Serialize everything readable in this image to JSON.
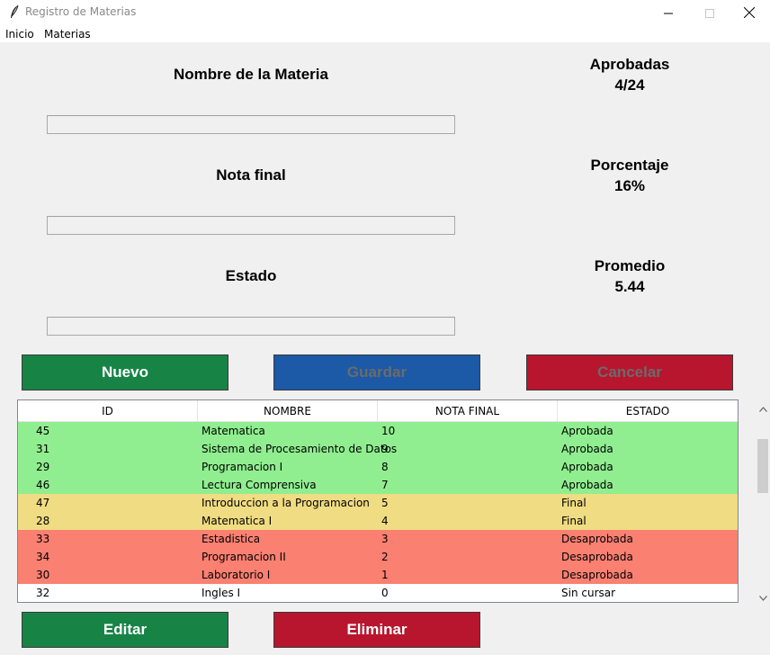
{
  "window": {
    "title": "Registro de Materias"
  },
  "menu": {
    "items": [
      "Inicio",
      "Materias"
    ]
  },
  "form": {
    "nombre_label": "Nombre de la Materia",
    "nota_label": "Nota final",
    "estado_label": "Estado",
    "nombre_value": "",
    "nota_value": "",
    "estado_value": ""
  },
  "stats": {
    "aprobadas_label": "Aprobadas",
    "aprobadas_value": "4/24",
    "porcentaje_label": "Porcentaje",
    "porcentaje_value": "16%",
    "promedio_label": "Promedio",
    "promedio_value": "5.44"
  },
  "buttons": {
    "nuevo": "Nuevo",
    "guardar": "Guardar",
    "cancelar": "Cancelar",
    "editar": "Editar",
    "eliminar": "Eliminar"
  },
  "table": {
    "headers": [
      "ID",
      "NOMBRE",
      "NOTA FINAL",
      "ESTADO"
    ],
    "rows": [
      {
        "id": "45",
        "nombre": "Matematica",
        "nota": "10",
        "estado": "Aprobada",
        "color": "#90ee90"
      },
      {
        "id": "31",
        "nombre": "Sistema de Procesamiento de Datos",
        "nota": "9",
        "estado": "Aprobada",
        "color": "#90ee90"
      },
      {
        "id": "29",
        "nombre": "Programacion I",
        "nota": "8",
        "estado": "Aprobada",
        "color": "#90ee90"
      },
      {
        "id": "46",
        "nombre": "Lectura Comprensiva",
        "nota": "7",
        "estado": "Aprobada",
        "color": "#90ee90"
      },
      {
        "id": "47",
        "nombre": "Introduccion a la Programacion",
        "nota": "5",
        "estado": "Final",
        "color": "#f0dc82"
      },
      {
        "id": "28",
        "nombre": "Matematica I",
        "nota": "4",
        "estado": "Final",
        "color": "#f0dc82"
      },
      {
        "id": "33",
        "nombre": "Estadistica",
        "nota": "3",
        "estado": "Desaprobada",
        "color": "#fa8072"
      },
      {
        "id": "34",
        "nombre": "Programacion II",
        "nota": "2",
        "estado": "Desaprobada",
        "color": "#fa8072"
      },
      {
        "id": "30",
        "nombre": "Laboratorio I",
        "nota": "1",
        "estado": "Desaprobada",
        "color": "#fa8072"
      },
      {
        "id": "32",
        "nombre": "Ingles I",
        "nota": "0",
        "estado": "Sin cursar",
        "color": "#ffffff"
      }
    ]
  },
  "icons": {
    "app": "feather-icon",
    "minimize": "minimize-icon",
    "maximize": "maximize-icon",
    "close": "close-icon",
    "scroll_up": "chevron-up-icon",
    "scroll_down": "chevron-down-icon"
  },
  "colors": {
    "green_button": "#178446",
    "blue_button": "#1c59a6",
    "red_button": "#b8162e",
    "row_aprobada": "#90ee90",
    "row_final": "#f0dc82",
    "row_desaprobada": "#fa8072"
  }
}
